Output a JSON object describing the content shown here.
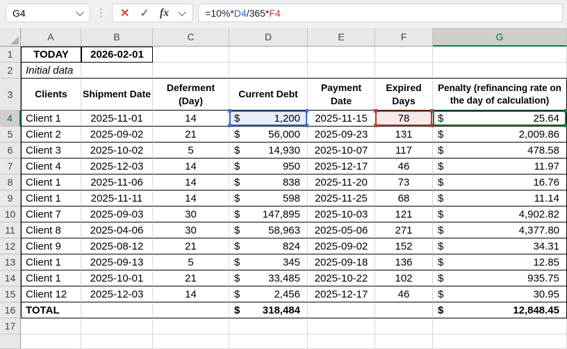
{
  "formula_bar": {
    "name_box_value": "G4",
    "cancel_icon": "✕",
    "enter_icon": "✓",
    "function_icon": "fx",
    "formula_segments": [
      {
        "text": "=10%*",
        "color": "#1b1b1b"
      },
      {
        "text": "D4",
        "color": "#2f5bd7"
      },
      {
        "text": "/365*",
        "color": "#1b1b1b"
      },
      {
        "text": "F4",
        "color": "#c23934"
      }
    ]
  },
  "sheet": {
    "column_headers": [
      "A",
      "B",
      "C",
      "D",
      "E",
      "F",
      "G"
    ],
    "row_numbers": [
      "1",
      "2",
      "3",
      "4",
      "5",
      "6",
      "7",
      "8",
      "9",
      "10",
      "11",
      "12",
      "13",
      "14",
      "15",
      "16",
      "17"
    ],
    "selected_column": "G",
    "selected_row": "4",
    "active_cell": "G4",
    "cells": {
      "A1": "TODAY",
      "B1": "2026-02-01",
      "A2": "Initial data"
    },
    "table_headers": [
      "Clients",
      "Shipment Date",
      "Deferment (Day)",
      "Current Debt",
      "Payment Date",
      "Expired Days",
      "Penalty (refinancing rate on the day of calculation)"
    ],
    "currency": "$",
    "rows": [
      {
        "client": "Client 1",
        "shipment_date": "2025-11-01",
        "deferment": "14",
        "current_debt": "1,200",
        "payment_date": "2025-11-15",
        "expired_days": "78",
        "penalty": "25.64"
      },
      {
        "client": "Client 2",
        "shipment_date": "2025-09-02",
        "deferment": "21",
        "current_debt": "56,000",
        "payment_date": "2025-09-23",
        "expired_days": "131",
        "penalty": "2,009.86"
      },
      {
        "client": "Client 3",
        "shipment_date": "2025-10-02",
        "deferment": "5",
        "current_debt": "14,930",
        "payment_date": "2025-10-07",
        "expired_days": "117",
        "penalty": "478.58"
      },
      {
        "client": "Client 4",
        "shipment_date": "2025-12-03",
        "deferment": "14",
        "current_debt": "950",
        "payment_date": "2025-12-17",
        "expired_days": "46",
        "penalty": "11.97"
      },
      {
        "client": "Client 1",
        "shipment_date": "2025-11-06",
        "deferment": "14",
        "current_debt": "838",
        "payment_date": "2025-11-20",
        "expired_days": "73",
        "penalty": "16.76"
      },
      {
        "client": "Client 1",
        "shipment_date": "2025-11-11",
        "deferment": "14",
        "current_debt": "598",
        "payment_date": "2025-11-25",
        "expired_days": "68",
        "penalty": "11.14"
      },
      {
        "client": "Client 7",
        "shipment_date": "2025-09-03",
        "deferment": "30",
        "current_debt": "147,895",
        "payment_date": "2025-10-03",
        "expired_days": "121",
        "penalty": "4,902.82"
      },
      {
        "client": "Client 8",
        "shipment_date": "2025-04-06",
        "deferment": "30",
        "current_debt": "58,963",
        "payment_date": "2025-05-06",
        "expired_days": "271",
        "penalty": "4,377.80"
      },
      {
        "client": "Client 9",
        "shipment_date": "2025-08-12",
        "deferment": "21",
        "current_debt": "824",
        "payment_date": "2025-09-02",
        "expired_days": "152",
        "penalty": "34.31"
      },
      {
        "client": "Client 1",
        "shipment_date": "2025-09-13",
        "deferment": "5",
        "current_debt": "345",
        "payment_date": "2025-09-18",
        "expired_days": "136",
        "penalty": "12.85"
      },
      {
        "client": "Client 1",
        "shipment_date": "2025-10-01",
        "deferment": "21",
        "current_debt": "33,485",
        "payment_date": "2025-10-22",
        "expired_days": "102",
        "penalty": "935.75"
      },
      {
        "client": "Client 12",
        "shipment_date": "2025-12-03",
        "deferment": "14",
        "current_debt": "2,456",
        "payment_date": "2025-12-17",
        "expired_days": "46",
        "penalty": "30.95"
      }
    ],
    "total_row": {
      "label": "TOTAL",
      "current_debt": "318,484",
      "penalty": "12,848.45"
    },
    "highlights": {
      "formula_ref_1": {
        "cell": "D4",
        "color": "#4472c4",
        "fill": "#e9eef8"
      },
      "formula_ref_2": {
        "cell": "F4",
        "color": "#b5423f",
        "fill": "#f8eaea"
      },
      "active_cell_border": {
        "cell": "G4",
        "color": "#127c42"
      }
    }
  }
}
